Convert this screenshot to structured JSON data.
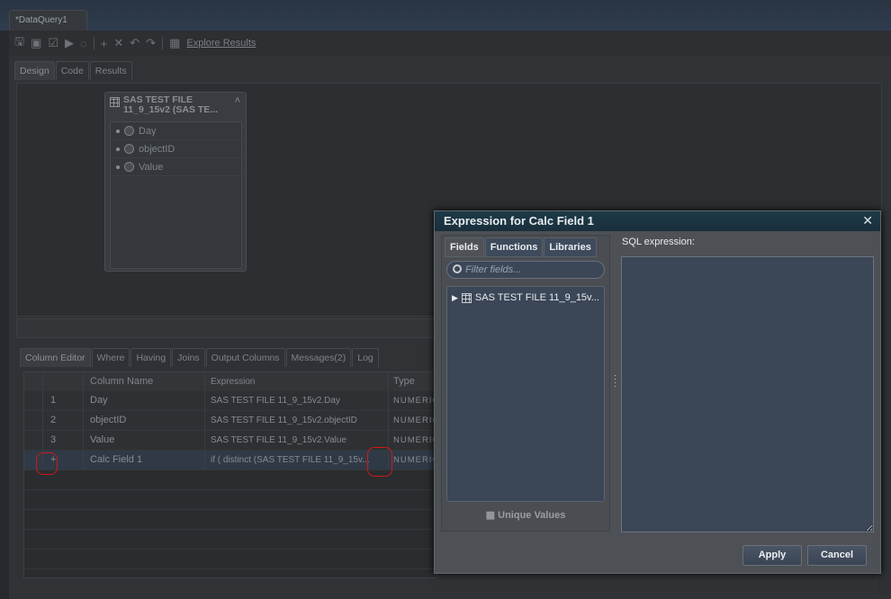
{
  "document_tab": "*DataQuery1",
  "toolbar": {
    "explore_results": "Explore Results"
  },
  "design_tabs": [
    "Design",
    "Code",
    "Results"
  ],
  "table_box": {
    "title_line1": "SAS TEST FILE",
    "title_line2": "11_9_15v2 (SAS TE...",
    "fields": [
      "Day",
      "objectID",
      "Value"
    ]
  },
  "bottom_tabs": [
    "Column Editor",
    "Where",
    "Having",
    "Joins",
    "Output Columns",
    "Messages(2)",
    "Log"
  ],
  "grid": {
    "headers": [
      "Column Name",
      "Expression",
      "Type"
    ],
    "rows": [
      {
        "num": "1",
        "name": "Day",
        "expr": "SAS TEST FILE 11_9_15v2.Day",
        "type": "NUMERIC"
      },
      {
        "num": "2",
        "name": "objectID",
        "expr": "SAS TEST FILE 11_9_15v2.objectID",
        "type": "NUMERIC"
      },
      {
        "num": "3",
        "name": "Value",
        "expr": "SAS TEST FILE 11_9_15v2.Value",
        "type": "NUMERIC"
      },
      {
        "num": "+",
        "name": "Calc Field 1",
        "expr": "if ( distinct (SAS TEST FILE 11_9_15v...",
        "type": "NUMERIC"
      }
    ]
  },
  "dialog": {
    "title": "Expression for Calc Field 1",
    "close": "✕",
    "tabs": [
      "Fields",
      "Functions",
      "Libraries"
    ],
    "filter_placeholder": "Filter fields...",
    "tree_item": "SAS TEST FILE 11_9_15v...",
    "unique_values": "Unique Values",
    "sql_label": "SQL expression:",
    "apply": "Apply",
    "cancel": "Cancel"
  }
}
